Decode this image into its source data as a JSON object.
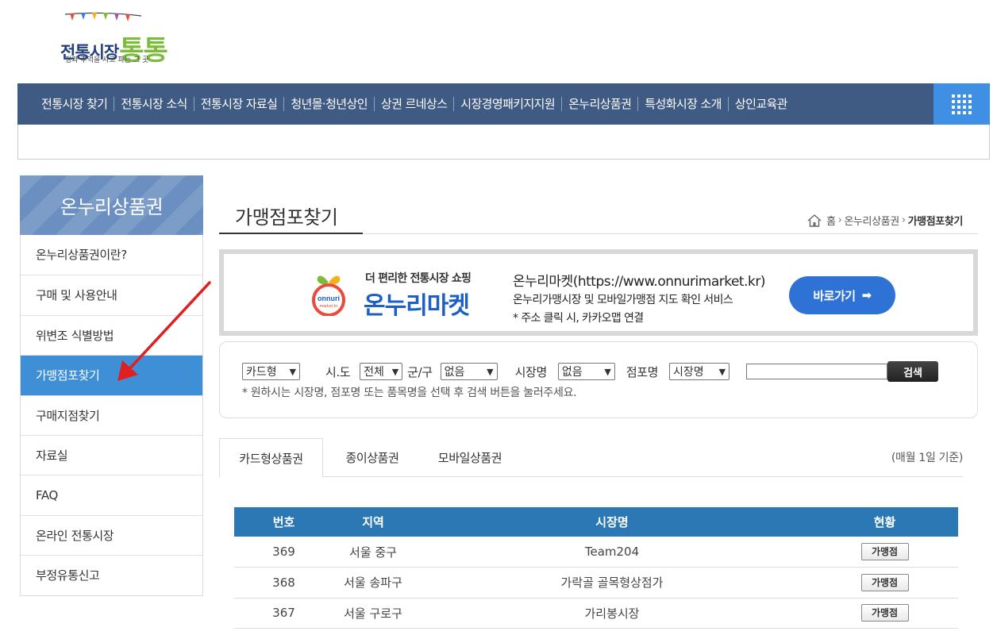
{
  "logo": {
    "text_main": "전통시장",
    "text_big": "통통",
    "subtitle": "정과 추억을 사고 파는 그 곳"
  },
  "gnb": {
    "items": [
      "전통시장 찾기",
      "전통시장 소식",
      "전통시장 자료실",
      "청년몰·청년상인",
      "상권 르네상스",
      "시장경영패키지지원",
      "온누리상품권",
      "특성화시장 소개",
      "상인교육관"
    ]
  },
  "sidebar": {
    "title": "온누리상품권",
    "items": [
      "온누리상품권이란?",
      "구매 및 사용안내",
      "위변조 식별방법",
      "가맹점포찾기",
      "구매지점찾기",
      "자료실",
      "FAQ",
      "온라인 전통시장",
      "부정유통신고"
    ],
    "active_index": 3
  },
  "page": {
    "title": "가맹점포찾기",
    "breadcrumb": [
      "홈",
      "온누리상품권",
      "가맹점포찾기"
    ]
  },
  "banner": {
    "tagline": "더 편리한 전통시장 쇼핑",
    "brand": "온누리마켓",
    "logo_text": "onnuri",
    "logo_sub": "market.kr",
    "line1": "온누리마켓(https://www.onnurimarket.kr)",
    "line2": "온누리가맹시장 및 모바일가맹점 지도 확인 서비스",
    "line3": "* 주소 클릭 시, 카카오맵 연결",
    "button": "바로가기",
    "button_arrow": "➡"
  },
  "search": {
    "type_select": "카드형",
    "sido_label": "시.도",
    "sido_select": "전체",
    "gugun_label": "군/구",
    "gugun_select": "없음",
    "market_label": "시장명",
    "market_select": "없음",
    "store_label": "점포명",
    "store_select": "시장명",
    "input_value": "",
    "button": "검색",
    "note": "* 원하시는 시장명, 점포명 또는 품목명을 선택 후 검색 버튼을 눌러주세요."
  },
  "tabs": {
    "items": [
      "카드형상품권",
      "종이상품권",
      "모바일상품권"
    ],
    "active_index": 0,
    "basis": "(매월 1일 기준)"
  },
  "table": {
    "headers": [
      "번호",
      "지역",
      "시장명",
      "현황"
    ],
    "rows": [
      {
        "no": "369",
        "region": "서울 중구",
        "market": "Team204",
        "status": "가맹점"
      },
      {
        "no": "368",
        "region": "서울 송파구",
        "market": "가락골 골목형상점가",
        "status": "가맹점"
      },
      {
        "no": "367",
        "region": "서울 구로구",
        "market": "가리봉시장",
        "status": "가맹점"
      }
    ]
  },
  "colors": {
    "gnb": "#3f5b84",
    "gnb_all": "#3f8fe5",
    "sidebar_active": "#3f8fd6",
    "table_header": "#2c78b5",
    "banner_button": "#2f72d6",
    "arrow": "#e02020"
  }
}
